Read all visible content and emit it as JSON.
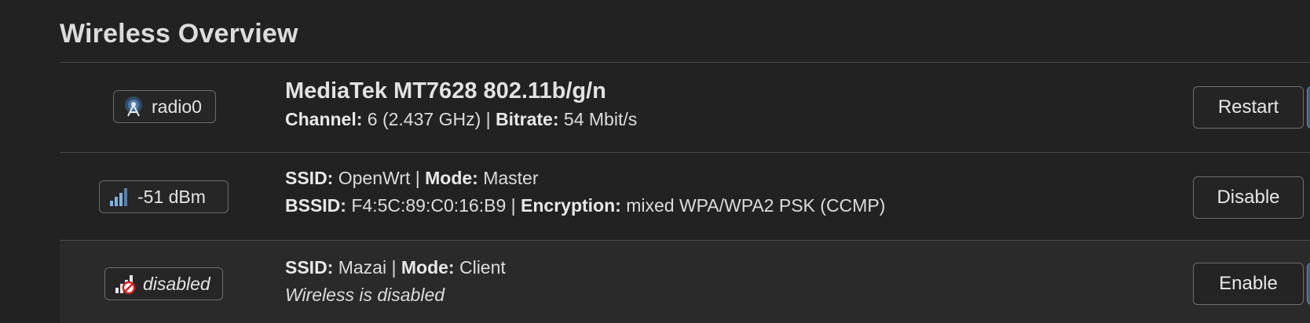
{
  "section": {
    "title": "Wireless Overview"
  },
  "radio": {
    "badge_label": "radio0",
    "icon": "radio-antenna-icon",
    "device_name": "MediaTek MT7628 802.11b/g/n",
    "channel_key": "Channel:",
    "channel_value": "6 (2.437 GHz)",
    "separator": "|",
    "bitrate_key": "Bitrate:",
    "bitrate_value": "54 Mbit/s",
    "button_label": "Restart"
  },
  "networks": [
    {
      "badge_label": "-51 dBm",
      "icon": "signal-strength-icon",
      "ssid_key": "SSID:",
      "ssid_value": "OpenWrt",
      "mode_key": "Mode:",
      "mode_value": "Master",
      "bssid_key": "BSSID:",
      "bssid_value": "F4:5C:89:C0:16:B9",
      "encryption_key": "Encryption:",
      "encryption_value": "mixed WPA/WPA2 PSK (CCMP)",
      "button_label": "Disable"
    },
    {
      "badge_label": "disabled",
      "icon": "signal-disabled-icon",
      "ssid_key": "SSID:",
      "ssid_value": "Mazai",
      "mode_key": "Mode:",
      "mode_value": "Client",
      "status": "Wireless is disabled",
      "button_label": "Enable"
    }
  ],
  "colors": {
    "background": "#222222",
    "alt_row": "#2a2a2a",
    "border": "#4a4a4a",
    "accent": "#3a5f80"
  }
}
